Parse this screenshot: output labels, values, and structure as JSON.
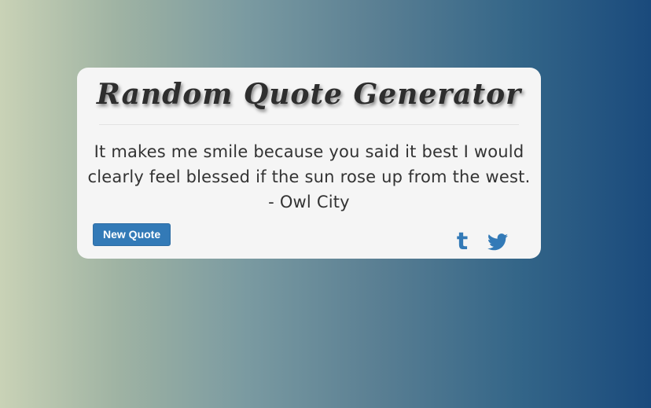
{
  "app": {
    "title": "Random Quote Generator"
  },
  "quote": {
    "text": "It makes me smile because you said it best I would clearly feel blessed if the sun rose up from the west.",
    "author": "- Owl City"
  },
  "actions": {
    "new_quote_label": "New Quote",
    "tumblr_glyph": "t",
    "tumblr_icon": "tumblr-icon",
    "twitter_icon": "twitter-icon"
  },
  "colors": {
    "accent": "#337ab7",
    "card_bg": "#f5f5f5",
    "gradient_start": "#c9d2b6",
    "gradient_end": "#1a4a7c"
  }
}
